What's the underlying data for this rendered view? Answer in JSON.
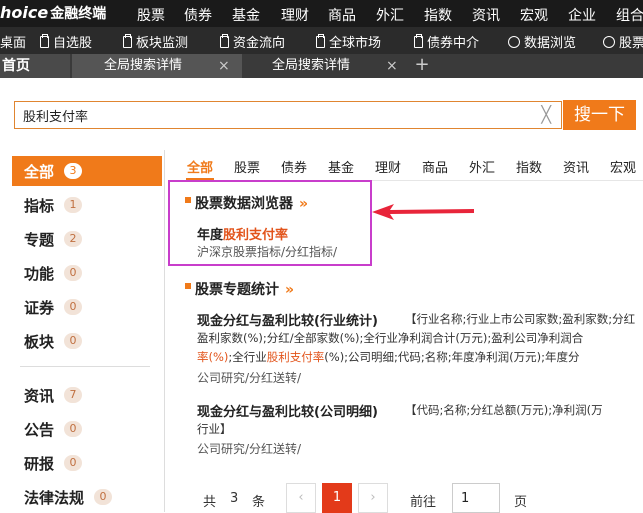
{
  "topnav": {
    "logo_latin": "hoice",
    "logo_cn": "金融终端",
    "items": [
      "股票",
      "债券",
      "基金",
      "理财",
      "商品",
      "外汇",
      "指数",
      "资讯",
      "宏观",
      "企业",
      "组合"
    ]
  },
  "toolbar": {
    "items": [
      {
        "label": "桌面",
        "icon": "desktop-icon"
      },
      {
        "label": "自选股",
        "icon": "document-icon"
      },
      {
        "label": "板块监测",
        "icon": "document-icon"
      },
      {
        "label": "资金流向",
        "icon": "document-icon"
      },
      {
        "label": "全球市场",
        "icon": "document-icon"
      },
      {
        "label": "债券中介",
        "icon": "document-icon"
      },
      {
        "label": "数据浏览",
        "icon": "gear-icon"
      },
      {
        "label": "股票",
        "icon": "gear-icon"
      }
    ]
  },
  "tabs": {
    "home": "首页",
    "tab1": "全局搜索详情",
    "tab2": "全局搜索详情",
    "close": "×",
    "add": "+"
  },
  "search": {
    "value": "股利支付率",
    "clear": "╳",
    "button": "搜一下"
  },
  "sidebar": {
    "items": [
      {
        "label": "全部",
        "count": "3"
      },
      {
        "label": "指标",
        "count": "1"
      },
      {
        "label": "专题",
        "count": "2"
      },
      {
        "label": "功能",
        "count": "0"
      },
      {
        "label": "证券",
        "count": "0"
      },
      {
        "label": "板块",
        "count": "0"
      },
      {
        "label": "资讯",
        "count": "7"
      },
      {
        "label": "公告",
        "count": "0"
      },
      {
        "label": "研报",
        "count": "0"
      },
      {
        "label": "法律法规",
        "count": "0"
      }
    ]
  },
  "categories": [
    "全部",
    "股票",
    "债券",
    "基金",
    "理财",
    "商品",
    "外汇",
    "指数",
    "资讯",
    "宏观"
  ],
  "results": {
    "section1": {
      "title": "股票数据浏览器",
      "arrow": "»",
      "item_prefix": "年度",
      "item_highlight": "股利支付率",
      "path": "沪深京股票指标/分红指标/"
    },
    "section2": {
      "title": "股票专题统计",
      "arrow": "»",
      "item1": {
        "title": "现金分红与盈利比较(行业统计)",
        "desc_line1": "【行业名称;行业上市公司家数;盈利家数;分红",
        "desc_line2": "盈利家数(%);分红/全部家数(%);全行业净利润合计(万元);盈利公司净利润合",
        "desc_line3_a": "率(%)",
        "desc_line3_b": ";全行业",
        "desc_line3_c": "股利支付率",
        "desc_line3_d": "(%);公司明细;代码;名称;年度净利润(万元);年度分",
        "path": "公司研究/分红送转/"
      },
      "item2": {
        "title": "现金分红与盈利比较(公司明细)",
        "desc_line1": "【代码;名称;分红总额(万元);净利润(万",
        "desc_line2": "行业】",
        "path": "公司研究/分红送转/"
      }
    }
  },
  "pagination": {
    "total_prefix": "共",
    "total": "3",
    "total_suffix": "条",
    "prev": "‹",
    "current": "1",
    "next": "›",
    "goto_label": "前往",
    "goto_value": "1",
    "goto_suffix": "页"
  },
  "colors": {
    "accent": "#f07a1a",
    "highlight_text": "#e2541b",
    "annotation": "#c83dcb",
    "arrow": "#e8253a"
  }
}
